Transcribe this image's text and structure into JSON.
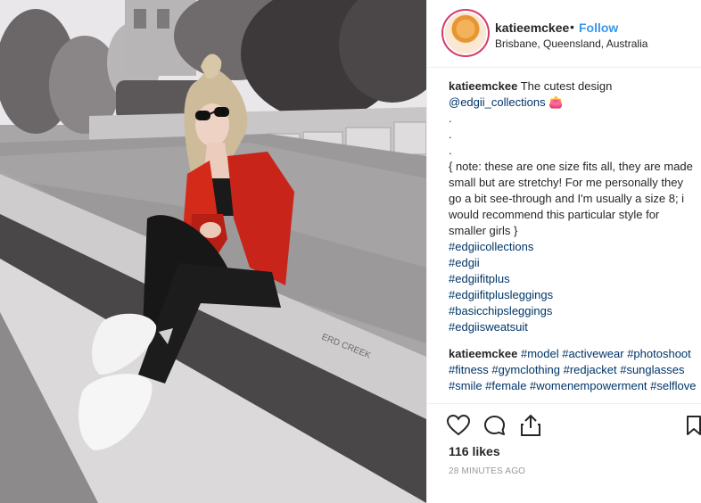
{
  "post": {
    "username": "katieemckee",
    "separator": "•",
    "follow_label": "Follow",
    "location": "Brisbane, Queensland, Australia"
  },
  "caption": {
    "username": "katieemckee",
    "text": "The cutest design",
    "mention": "@edgii_collections",
    "emoji": "👛",
    "dots": [
      ".",
      ".",
      "."
    ],
    "note": "{ note: these are one size fits all, they are made small but are stretchy! For me personally they go a bit see-through and I'm usually a size 8; i would recommend this particular style for smaller girls }",
    "hashtags": [
      "#edgiicollections",
      "#edgii",
      "#edgiifitplus",
      "#edgiifitplusleggings",
      "#basicchipsleggings",
      "#edgiisweatsuit"
    ]
  },
  "comment": {
    "username": "katieemckee",
    "text": "#model #activewear #photoshoot #fitness #gymclothing #redjacket #sunglasses #smile #female #womenempowerment #selflove"
  },
  "actions": {
    "icons": [
      "heart-icon",
      "comment-icon",
      "share-icon",
      "bookmark-icon"
    ]
  },
  "likes": "116 likes",
  "timestamp": "28 MINUTES AGO",
  "colors": {
    "link": "#3897f0",
    "hashtag": "#003569",
    "jacket": "#d32a1a",
    "avatar_ring": "#d33c6a"
  }
}
